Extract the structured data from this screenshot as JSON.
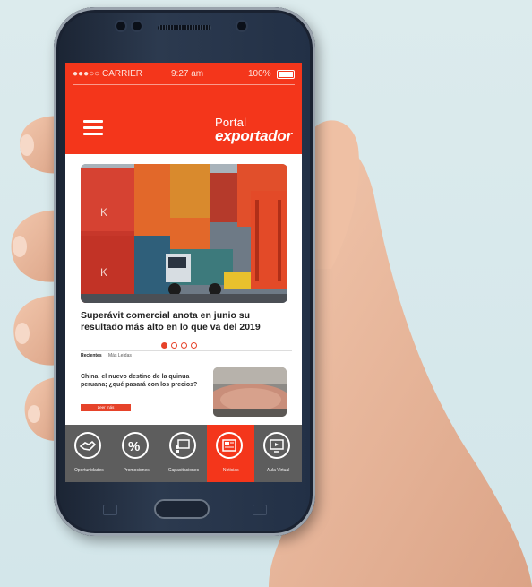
{
  "status_bar": {
    "carrier": "●●●○○ CARRIER",
    "time": "9:27 am",
    "battery": "100%"
  },
  "app": {
    "logo_line1": "Portal",
    "logo_line2": "exportador"
  },
  "colors": {
    "brand_red": "#f4361b",
    "nav_gray": "#5d5d5d"
  },
  "featured": {
    "headline": "Superávit comercial anota en junio su resultado más alto en lo que va del 2019",
    "carousel_dots": 4,
    "active_dot": 1
  },
  "tabs": [
    "Recientes",
    "Más Leídas"
  ],
  "news": [
    {
      "title": "China, el nuevo destino de la quinua peruana; ¿qué pasará con los precios?",
      "button": "Leer más"
    }
  ],
  "bottom_nav": [
    {
      "label": "Oportunidades",
      "icon": "handshake-icon"
    },
    {
      "label": "Promociones",
      "icon": "percent-icon"
    },
    {
      "label": "Capacitaciones",
      "icon": "presentation-icon"
    },
    {
      "label": "Noticias",
      "icon": "newspaper-icon",
      "active": true
    },
    {
      "label": "Aula Virtual",
      "icon": "monitor-icon"
    }
  ]
}
